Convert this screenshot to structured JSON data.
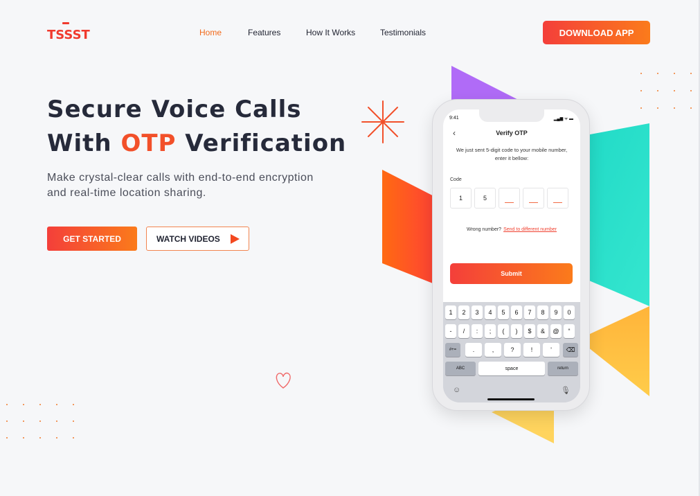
{
  "brand": {
    "logo_text": "TSSST",
    "accent": "#f2502a"
  },
  "nav": {
    "items": [
      {
        "label": "Home",
        "active": true
      },
      {
        "label": "Features",
        "active": false
      },
      {
        "label": "How It Works",
        "active": false
      },
      {
        "label": "Testimonials",
        "active": false
      }
    ],
    "download_label": "DOWNLOAD APP"
  },
  "hero": {
    "title_line1": "Secure Voice Calls",
    "title_line2_pre": "With ",
    "title_line2_accent": "OTP",
    "title_line2_post": " Verification",
    "subtitle": "Make crystal-clear calls with end-to-end encryption and real-time location sharing.",
    "primary_cta": "GET STARTED",
    "secondary_cta": "WATCH VIDEOS"
  },
  "phone": {
    "time": "9:41",
    "status": "▂▄▆ ᯤ ▬",
    "title": "Verify OTP",
    "description": "We just sent 5-digit code to your mobile number, enter it bellow:",
    "code_label": "Code",
    "code_digits": [
      "1",
      "5",
      "",
      "",
      ""
    ],
    "wrong_text": "Wrong number?",
    "wrong_link": "Send to different number",
    "submit_label": "Submit",
    "keyboard": {
      "row1": [
        "1",
        "2",
        "3",
        "4",
        "5",
        "6",
        "7",
        "8",
        "9",
        "0"
      ],
      "row2": [
        "-",
        "/",
        ":",
        ";",
        "(",
        ")",
        "$",
        "&",
        "@",
        "“"
      ],
      "row3": [
        "#+=",
        ".",
        ",",
        "?",
        "!",
        "’",
        "⌫"
      ],
      "row4": [
        "ABC",
        "space",
        "return"
      ]
    }
  },
  "icons": [
    "sparkle-icon",
    "heart-icon",
    "play-icon",
    "back-arrow-icon",
    "emoji-icon",
    "microphone-icon",
    "backspace-icon"
  ],
  "colors": {
    "gradient_start": "#f43f3a",
    "gradient_end": "#fb7b1b",
    "purple": "#b06bf7",
    "teal": "#2ee0c8",
    "orange": "#fa7a1c",
    "yellow": "#ffc43c"
  }
}
